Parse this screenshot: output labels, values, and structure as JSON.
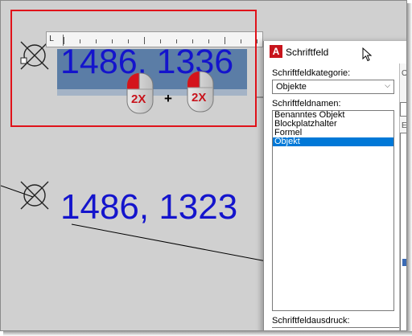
{
  "drawing": {
    "edited_text": "1486, 1336",
    "placed_text": "1486, 1323",
    "ruler_tab_glyph": "L",
    "plus_sign": "+",
    "mouse_left_label": "2X",
    "mouse_right_label": "2X",
    "text_color": "#1414cc",
    "highlight_color": "#e0121a"
  },
  "dialog": {
    "title": "Schriftfeld",
    "app_icon_letter": "A",
    "category_label": "Schriftfeldkategorie:",
    "category_value": "Objekte",
    "names_label": "Schriftfeldnamen:",
    "names": [
      {
        "label": "Benanntes Objekt",
        "selected": false
      },
      {
        "label": "Blockplatzhalter",
        "selected": false
      },
      {
        "label": "Formel",
        "selected": false
      },
      {
        "label": "Objekt",
        "selected": true
      }
    ],
    "expression_label": "Schriftfeldausdruck:",
    "right_column_fragment_top": "O",
    "right_column_fragment_mid": "E",
    "selection_color": "#0078d7"
  }
}
